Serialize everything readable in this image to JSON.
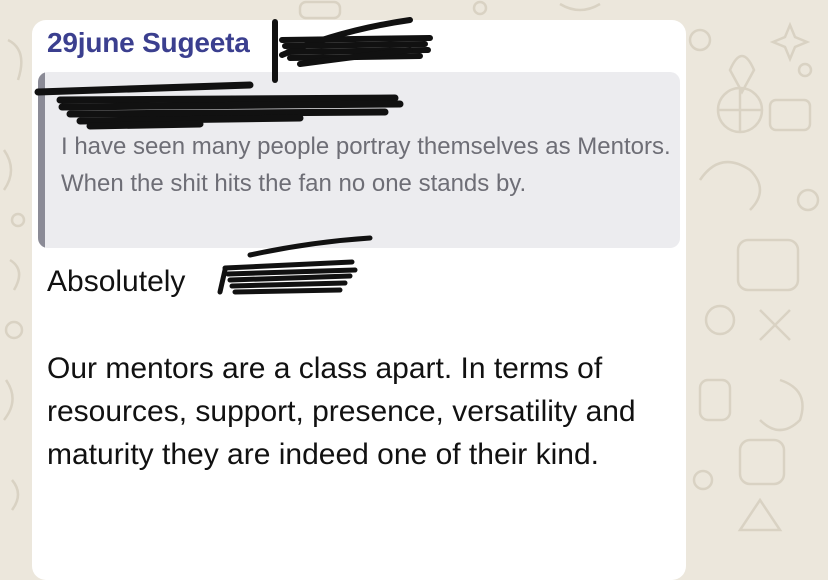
{
  "message": {
    "sender": "29june Sugeeta",
    "quoted": {
      "author": "",
      "text": "I have seen many people portray themselves as Mentors. When the shit hits the fan no one stands by."
    },
    "reply_line1": "Absolutely",
    "reply_paragraph": "Our mentors are a class apart. In terms of resources, support, presence, versatility and maturity they are indeed one of their kind."
  },
  "colors": {
    "bubble": "#ffffff",
    "sender": "#3b3f8f",
    "quote_background": "#ececef",
    "quote_bar": "#8b8b96",
    "wallpaper": "#ece7dc",
    "redaction": "#111111"
  },
  "icons": [
    "doodle-wallpaper-icons",
    "location-pin-icon",
    "basketball-icon",
    "sparkle-icon",
    "microphone-icon"
  ]
}
